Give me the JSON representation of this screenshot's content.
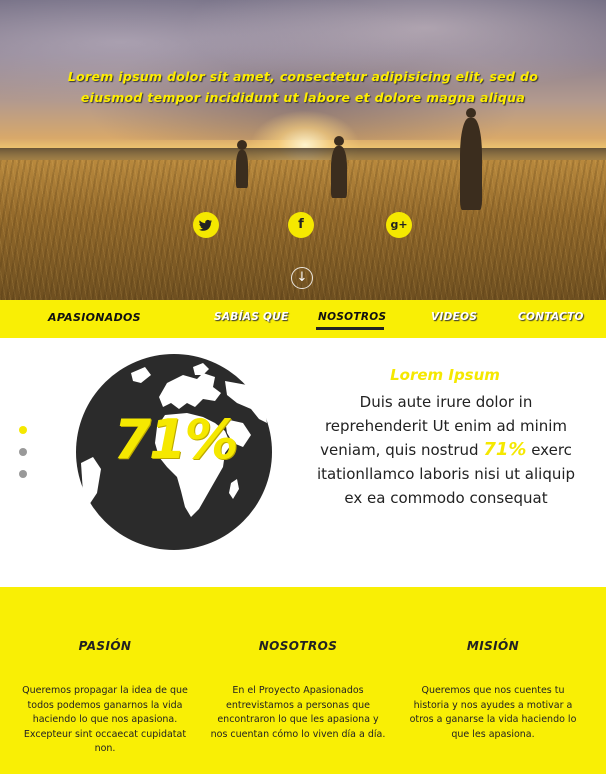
{
  "hero": {
    "heading": "Lorem ipsum dolor sit amet, consectetur adipisicing elit, sed do eiusmod tempor incididunt ut labore et dolore magna aliqua",
    "social": [
      {
        "icon": "twitter-icon",
        "glyph": "🐦"
      },
      {
        "icon": "facebook-icon",
        "glyph": "f"
      },
      {
        "icon": "google-plus-icon",
        "glyph": "g+"
      }
    ],
    "scroll_glyph": "↓"
  },
  "nav": {
    "brand": "APASIONADOS",
    "items": [
      "SABÍAS QUE",
      "NOSOTROS",
      "VIDEOS",
      "CONTACTO"
    ],
    "active": "NOSOTROS"
  },
  "main": {
    "stat": "71%",
    "title": "Lorem Ipsum",
    "text_before": "Duis aute irure dolor in reprehenderit Ut enim ad minim veniam, quis nostrud ",
    "text_highlight": "71%",
    "text_after": " exerc itationllamco laboris nisi ut aliquip ex ea commodo consequat",
    "slider_dots": 3,
    "active_dot": 0
  },
  "bottom": {
    "columns": [
      {
        "title": "PASIÓN",
        "text": "Queremos propagar la idea de que todos podemos ganarnos la vida haciendo lo que nos apasiona. Excepteur sint occaecat cupidatat non."
      },
      {
        "title": "NOSOTROS",
        "text": "En el Proyecto Apasionados entrevistamos a personas que encontraron lo que les apasiona y nos cuentan cómo lo viven día a día."
      },
      {
        "title": "MISIÓN",
        "text": "Queremos que nos cuentes tu historia y nos ayudes a motivar a otros a ganarse la vida haciendo lo que les apasiona."
      }
    ]
  },
  "colors": {
    "accent": "#f9ef05",
    "text": "#222222"
  }
}
